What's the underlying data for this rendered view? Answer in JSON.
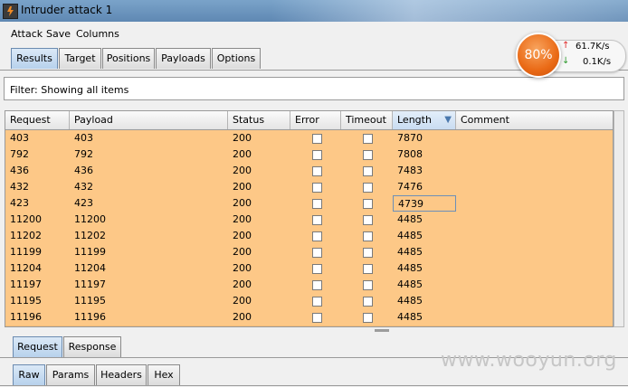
{
  "window": {
    "title": "Intruder attack 1"
  },
  "menu": [
    "Attack",
    "Save",
    "Columns"
  ],
  "tabs": [
    "Results",
    "Target",
    "Positions",
    "Payloads",
    "Options"
  ],
  "filter": {
    "text": "Filter:  Showing all items"
  },
  "table": {
    "columns": [
      "Request",
      "Payload",
      "Status",
      "Error",
      "Timeout",
      "Length",
      "Comment"
    ],
    "sorted_column": "Length",
    "sort_direction": "descending",
    "row_color": "#fdc887",
    "rows": [
      {
        "request": "403",
        "payload": "403",
        "status": "200",
        "length": "7870"
      },
      {
        "request": "792",
        "payload": "792",
        "status": "200",
        "length": "7808"
      },
      {
        "request": "436",
        "payload": "436",
        "status": "200",
        "length": "7483"
      },
      {
        "request": "432",
        "payload": "432",
        "status": "200",
        "length": "7476"
      },
      {
        "request": "423",
        "payload": "423",
        "status": "200",
        "length": "4739"
      },
      {
        "request": "11200",
        "payload": "11200",
        "status": "200",
        "length": "4485"
      },
      {
        "request": "11202",
        "payload": "11202",
        "status": "200",
        "length": "4485"
      },
      {
        "request": "11199",
        "payload": "11199",
        "status": "200",
        "length": "4485"
      },
      {
        "request": "11204",
        "payload": "11204",
        "status": "200",
        "length": "4485"
      },
      {
        "request": "11197",
        "payload": "11197",
        "status": "200",
        "length": "4485"
      },
      {
        "request": "11195",
        "payload": "11195",
        "status": "200",
        "length": "4485"
      },
      {
        "request": "11196",
        "payload": "11196",
        "status": "200",
        "length": "4485"
      }
    ]
  },
  "viewer_tabs": [
    "Request",
    "Response"
  ],
  "message_tabs": [
    "Raw",
    "Params",
    "Headers",
    "Hex"
  ],
  "speed_widget": {
    "percent": "80%",
    "upload": "61.7K/s",
    "download": "0.1K/s"
  },
  "watermark": "www.wooyun.org"
}
